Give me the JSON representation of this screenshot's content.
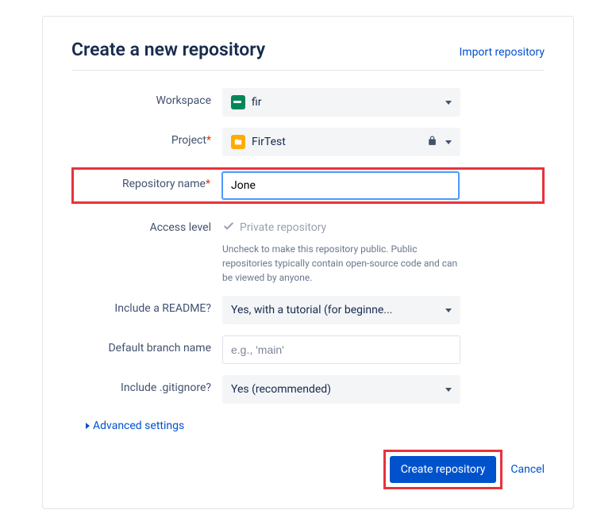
{
  "header": {
    "title": "Create a new repository",
    "import_link": "Import repository"
  },
  "fields": {
    "workspace": {
      "label": "Workspace",
      "value": "fir"
    },
    "project": {
      "label": "Project",
      "value": "FirTest"
    },
    "repo_name": {
      "label": "Repository name",
      "value": "Jone"
    },
    "access": {
      "label": "Access level",
      "checkbox_label": "Private repository",
      "help": "Uncheck to make this repository public. Public repositories typically contain open-source code and can be viewed by anyone."
    },
    "readme": {
      "label": "Include a README?",
      "value": "Yes, with a tutorial (for beginne..."
    },
    "branch": {
      "label": "Default branch name",
      "placeholder": "e.g., 'main'"
    },
    "gitignore": {
      "label": "Include .gitignore?",
      "value": "Yes (recommended)"
    }
  },
  "advanced": "Advanced settings",
  "actions": {
    "submit": "Create repository",
    "cancel": "Cancel"
  }
}
